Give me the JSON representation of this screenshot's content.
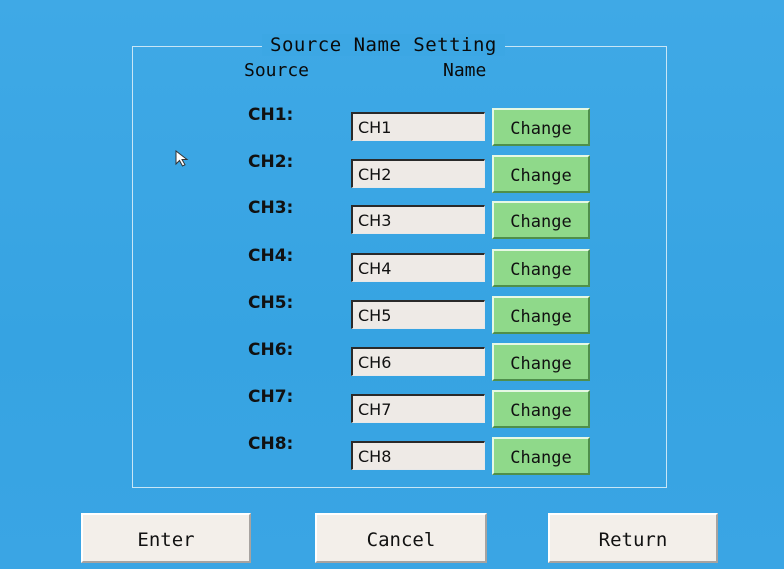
{
  "group_title": "Source Name Setting",
  "columns": {
    "source": "Source",
    "name": "Name"
  },
  "channels": [
    {
      "label": "CH1:",
      "name": "CH1",
      "button": "Change"
    },
    {
      "label": "CH2:",
      "name": "CH2",
      "button": "Change"
    },
    {
      "label": "CH3:",
      "name": "CH3",
      "button": "Change"
    },
    {
      "label": "CH4:",
      "name": "CH4",
      "button": "Change"
    },
    {
      "label": "CH5:",
      "name": "CH5",
      "button": "Change"
    },
    {
      "label": "CH6:",
      "name": "CH6",
      "button": "Change"
    },
    {
      "label": "CH7:",
      "name": "CH7",
      "button": "Change"
    },
    {
      "label": "CH8:",
      "name": "CH8",
      "button": "Change"
    }
  ],
  "footer": {
    "enter_label": "Enter",
    "cancel_label": "Cancel",
    "return_label": "Return"
  },
  "colors": {
    "background": "#3aa6e3",
    "change_button": "#8fd98a",
    "field_background": "#eeeae6",
    "footer_button": "#f3efea"
  },
  "icons": {
    "pointer": "mouse-pointer-icon"
  }
}
